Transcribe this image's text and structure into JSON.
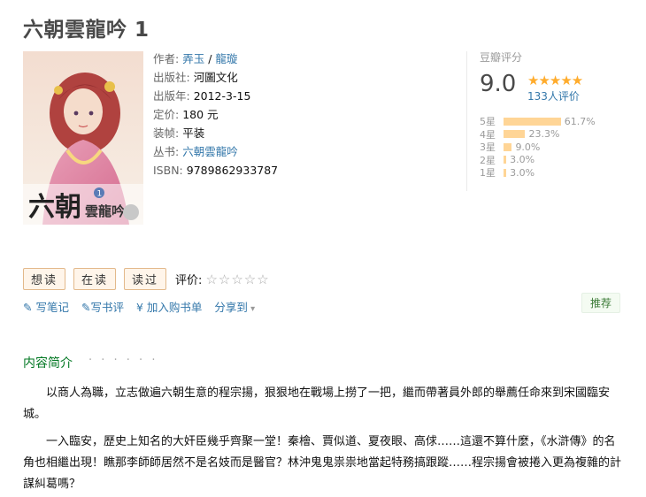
{
  "title": "六朝雲龍吟 1",
  "cover": {
    "logo_text": "六朝",
    "logo_text2": "雲龍吟",
    "badge": "1"
  },
  "info": {
    "author_label": "作者:",
    "author_1": "弄玉",
    "author_sep": " / ",
    "author_2": "龍璇",
    "publisher_label": "出版社:",
    "publisher": "河圖文化",
    "year_label": "出版年:",
    "year": "2012-3-15",
    "price_label": "定价:",
    "price": "180 元",
    "binding_label": "装帧:",
    "binding": "平装",
    "series_label": "丛书:",
    "series": "六朝雲龍吟",
    "isbn_label": "ISBN:",
    "isbn": "9789862933787"
  },
  "rating": {
    "label": "豆瓣评分",
    "score": "9.0",
    "stars": "★★★★★",
    "votes": "133人评价",
    "distribution": [
      {
        "star": "5星",
        "pct": "61.7%",
        "value": 61.7
      },
      {
        "star": "4星",
        "pct": "23.3%",
        "value": 23.3
      },
      {
        "star": "3星",
        "pct": "9.0%",
        "value": 9.0
      },
      {
        "star": "2星",
        "pct": "3.0%",
        "value": 3.0
      },
      {
        "star": "1星",
        "pct": "3.0%",
        "value": 3.0
      }
    ]
  },
  "actions": {
    "want": "想读",
    "reading": "在读",
    "read": "读过",
    "rate_label": "评价:",
    "rate_stars": "☆☆☆☆☆"
  },
  "links": {
    "note": "写笔记",
    "review": "写书评",
    "cart_prefix": "¥",
    "cart": "加入购书单",
    "share": "分享到"
  },
  "recommend": "推荐",
  "intro": {
    "title": "内容简介",
    "dots": "· · · · · ·",
    "p1": "以商人為職，立志做遍六朝生意的程宗揚，狠狠地在戰場上撈了一把，繼而帶著員外郎的舉薦任命來到宋國臨安城。",
    "p2": "一入臨安，歷史上知名的大奸臣幾乎齊聚一堂！秦檜、賈似道、夏夜眼、高俅……這還不算什麼，《水滸傳》的名角也相繼出現！瞧那李師師居然不是名妓而是醫官？林沖鬼鬼祟祟地當起特務搞跟蹤……程宗揚會被捲入更為複雜的計謀糾葛嗎？"
  },
  "colors": {
    "link": "#3377aa",
    "star": "#ffac2d",
    "bar": "#ffd596",
    "section": "#007722"
  }
}
